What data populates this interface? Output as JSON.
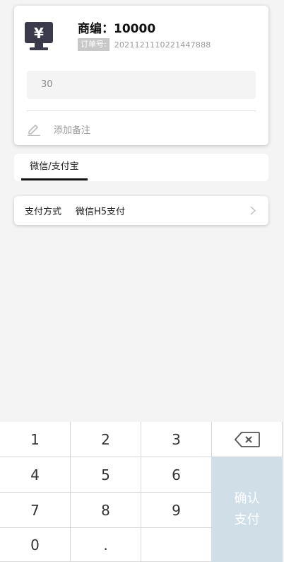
{
  "merchant": {
    "title": "商编：10000",
    "order_label": "订单号:",
    "order_no": "2021121110221447888"
  },
  "amount": {
    "value": "30"
  },
  "remark": {
    "placeholder": "添加备注",
    "icon": "pencil-icon"
  },
  "tabs": [
    {
      "label": "微信/支付宝",
      "active": true
    }
  ],
  "pay_method": {
    "label": "支付方式",
    "value": "微信H5支付",
    "icon": "chevron-right-icon"
  },
  "keypad": {
    "keys": [
      "1",
      "2",
      "3",
      "4",
      "5",
      "6",
      "7",
      "8",
      "9",
      "0",
      "."
    ],
    "backspace_icon": "backspace-icon",
    "confirm_line1": "确认",
    "confirm_line2": "支付"
  },
  "colors": {
    "background": "#f4f4f4",
    "confirm_bg": "#d0dee7",
    "icon_dark": "#3a3a4a"
  }
}
